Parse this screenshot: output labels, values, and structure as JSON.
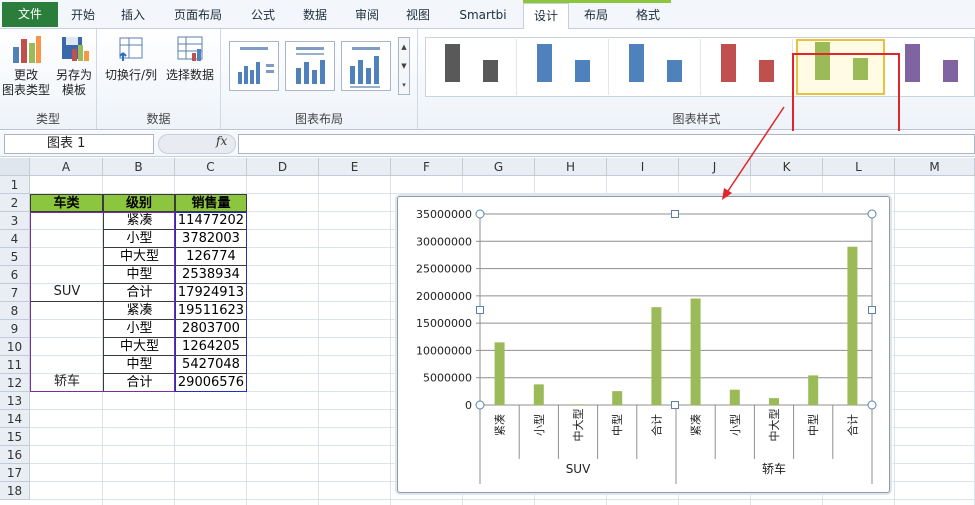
{
  "ribbon": {
    "tabs": [
      "文件",
      "开始",
      "插入",
      "页面布局",
      "公式",
      "数据",
      "审阅",
      "视图",
      "Smartbi",
      "设计",
      "布局",
      "格式"
    ],
    "active_tab": "设计",
    "groups": {
      "type": {
        "label": "类型",
        "change_chart_type": "更改图表类型",
        "change_chart_type_l1": "更改",
        "change_chart_type_l2": "图表类型",
        "save_template_l1": "另存为",
        "save_template_l2": "模板"
      },
      "data": {
        "label": "数据",
        "switch_row_col": "切换行/列",
        "select_data": "选择数据"
      },
      "layout": {
        "label": "图表布局"
      },
      "styles": {
        "label": "图表样式",
        "swatches": [
          "#595959",
          "#4f81bd",
          "#4f81bd",
          "#c0504d",
          "#9bbb59",
          "#8064a2"
        ],
        "selected_index": 4
      }
    }
  },
  "formula_bar": {
    "name_box": "图表 1",
    "fx": "fx"
  },
  "sheet": {
    "columns": [
      "A",
      "B",
      "C",
      "D",
      "E",
      "F",
      "G",
      "H",
      "I",
      "J",
      "K",
      "L",
      "M"
    ],
    "rows": [
      "1",
      "2",
      "3",
      "4",
      "5",
      "6",
      "7",
      "8",
      "9",
      "10",
      "11",
      "12",
      "13",
      "14",
      "15",
      "16",
      "17",
      "18"
    ],
    "table": {
      "headers": [
        "车类",
        "级别",
        "销售量"
      ],
      "groups": [
        {
          "name": "SUV",
          "rows": [
            {
              "level": "紧凑",
              "sales": "11477202"
            },
            {
              "level": "小型",
              "sales": "3782003"
            },
            {
              "level": "中大型",
              "sales": "126774"
            },
            {
              "level": "中型",
              "sales": "2538934"
            },
            {
              "level": "合计",
              "sales": "17924913"
            }
          ]
        },
        {
          "name": "轿车",
          "rows": [
            {
              "level": "紧凑",
              "sales": "19511623"
            },
            {
              "level": "小型",
              "sales": "2803700"
            },
            {
              "level": "中大型",
              "sales": "1264205"
            },
            {
              "level": "中型",
              "sales": "5427048"
            },
            {
              "level": "合计",
              "sales": "29006576"
            }
          ]
        }
      ]
    }
  },
  "chart_data": {
    "type": "bar",
    "categories": [
      "紧凑",
      "小型",
      "中大型",
      "中型",
      "合计",
      "紧凑",
      "小型",
      "中大型",
      "中型",
      "合计"
    ],
    "groups": [
      "SUV",
      "轿车"
    ],
    "values": [
      11477202,
      3782003,
      126774,
      2538934,
      17924913,
      19511623,
      2803700,
      1264205,
      5427048,
      29006576
    ],
    "ylim": [
      0,
      35000000
    ],
    "yticks": [
      "0",
      "5000000",
      "10000000",
      "15000000",
      "20000000",
      "25000000",
      "30000000",
      "35000000"
    ],
    "color": "#9bbb59",
    "grid": true,
    "legend": "none"
  }
}
